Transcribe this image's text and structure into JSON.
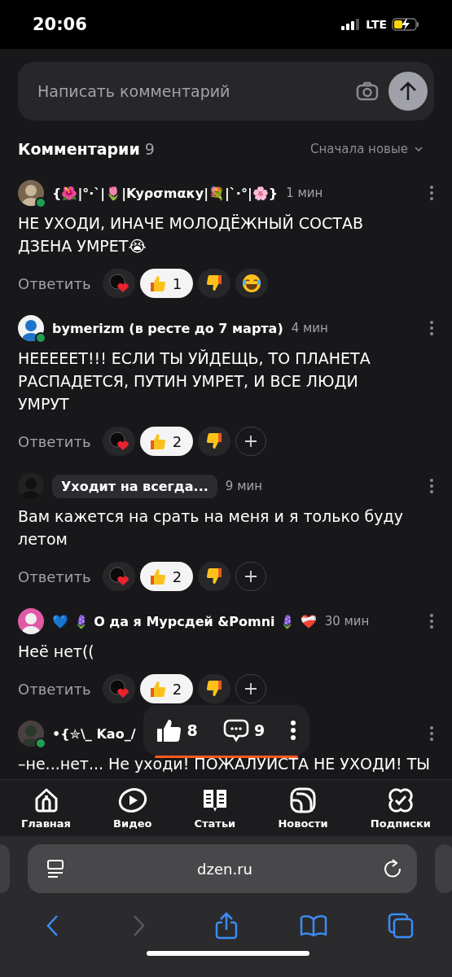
{
  "status_bar": {
    "time": "20:06",
    "network": "LTE"
  },
  "comment_input": {
    "placeholder": "Написать комментарий"
  },
  "comments_header": {
    "title": "Комментарии",
    "count": "9",
    "sort": "Сначала новые"
  },
  "comments": [
    {
      "author": "{🌺|°·`|🌷|Kyρσmακy|💐|`·°|🌸}",
      "name_badge": false,
      "online": true,
      "time": "1 мин",
      "text": "НЕ УХОДИ, ИНАЧЕ МОЛОДЁЖНЫЙ СОСТАВ ДЗЕНА УМРЕТ😭",
      "reply": "Ответить",
      "reactions": [
        {
          "kind": "heart",
          "selected": false
        },
        {
          "kind": "like",
          "count": "1",
          "selected": true
        },
        {
          "kind": "dislike",
          "selected": false
        },
        {
          "kind": "laugh",
          "selected": false
        }
      ]
    },
    {
      "author": "bymerizm (в ресте до 7 марта)",
      "name_badge": false,
      "online": true,
      "time": "4 мин",
      "text": "НЕЕЕЕЕТ!!! ЕСЛИ ТЫ УЙДЕЩЬ, ТО ПЛАНЕТА РАСПАДЕТСЯ, ПУТИН УМРЕТ, И ВСЕ ЛЮДИ УМРУТ",
      "reply": "Ответить",
      "reactions": [
        {
          "kind": "heart",
          "selected": false
        },
        {
          "kind": "like",
          "count": "2",
          "selected": true
        },
        {
          "kind": "dislike",
          "selected": false
        },
        {
          "kind": "add",
          "selected": false
        }
      ]
    },
    {
      "author": "Уходит на всегда...",
      "name_badge": true,
      "online": false,
      "time": "9 мин",
      "text": "Вам кажется на срать на меня и я только буду летом",
      "reply": "Ответить",
      "reactions": [
        {
          "kind": "heart",
          "selected": false
        },
        {
          "kind": "like",
          "count": "2",
          "selected": true
        },
        {
          "kind": "dislike",
          "selected": false
        },
        {
          "kind": "add",
          "selected": false
        }
      ]
    },
    {
      "author": "💙 🪻 О да я Мурсдей &Pomni 🪻 ❤️‍🩹",
      "name_badge": false,
      "online": false,
      "time": "30 мин",
      "text": "Неё нет((",
      "reply": "Ответить",
      "reactions": [
        {
          "kind": "heart",
          "selected": false
        },
        {
          "kind": "like",
          "count": "2",
          "selected": true
        },
        {
          "kind": "dislike",
          "selected": false
        },
        {
          "kind": "add",
          "selected": false
        }
      ]
    },
    {
      "author": "•{✮\\_ Kao_/",
      "name_badge": false,
      "online": true,
      "text": "–не...нет... Не уходи! ПОЖАЛУИСТА НЕ УХОДИ! ТЫ"
    }
  ],
  "floating_bar": {
    "likes": "8",
    "comments": "9"
  },
  "bottom_nav": [
    {
      "label": "Главная"
    },
    {
      "label": "Видео"
    },
    {
      "label": "Статьи"
    },
    {
      "label": "Новости"
    },
    {
      "label": "Подписки"
    }
  ],
  "browser": {
    "url": "dzen.ru"
  }
}
